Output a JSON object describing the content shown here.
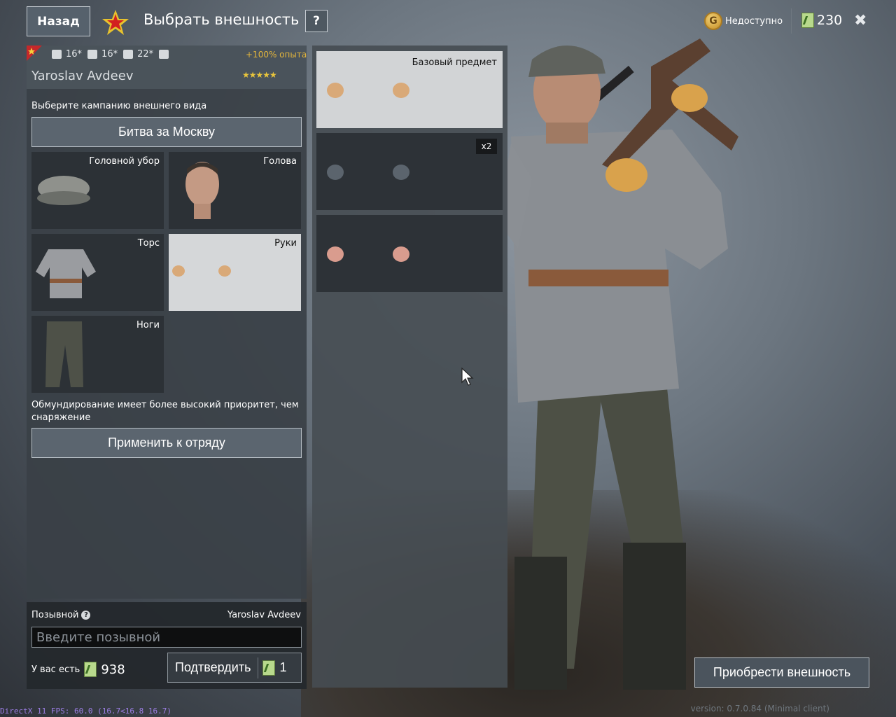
{
  "header": {
    "back_label": "Назад",
    "title": "Выбрать внешность",
    "help_label": "?",
    "gold_status": "Недоступно",
    "gold_icon_letter": "G",
    "cash": "230",
    "close_label": "✖"
  },
  "soldier": {
    "stats": [
      "16*",
      "16*",
      "22*"
    ],
    "xp_bonus": "+100% опыта",
    "name": "Yaroslav Avdeev",
    "rank_stars": "★★★★★"
  },
  "appearance": {
    "campaign_prompt": "Выберите кампанию внешнего вида",
    "campaign": "Битва за Москву",
    "slots": [
      {
        "label": "Головной убор"
      },
      {
        "label": "Голова"
      },
      {
        "label": "Торс"
      },
      {
        "label": "Руки"
      },
      {
        "label": "Ноги"
      }
    ],
    "priority_note": "Обмундирование имеет более высокий приоритет, чем снаряжение",
    "apply_label": "Применить к отряду"
  },
  "variants": {
    "base_label": "Базовый предмет",
    "count_badge": "x2"
  },
  "callsign": {
    "label": "Позывной",
    "current": "Yaroslav Avdeev",
    "placeholder": "Введите позывной",
    "have_label": "У вас есть",
    "have_amount": "938",
    "confirm_label": "Подтвердить",
    "confirm_cost": "1"
  },
  "buy_label": "Приобрести внешность",
  "fps": "DirectX 11 FPS: 60.0 (16.7<16.8 16.7)",
  "version": "version: 0.7.0.84 (Minimal client)",
  "colors": {
    "accent_gold": "#e3b53c",
    "cash_green": "#b8d98c",
    "selected_slot": "#d5d7d9",
    "fps_purple": "#9d7fe6"
  }
}
